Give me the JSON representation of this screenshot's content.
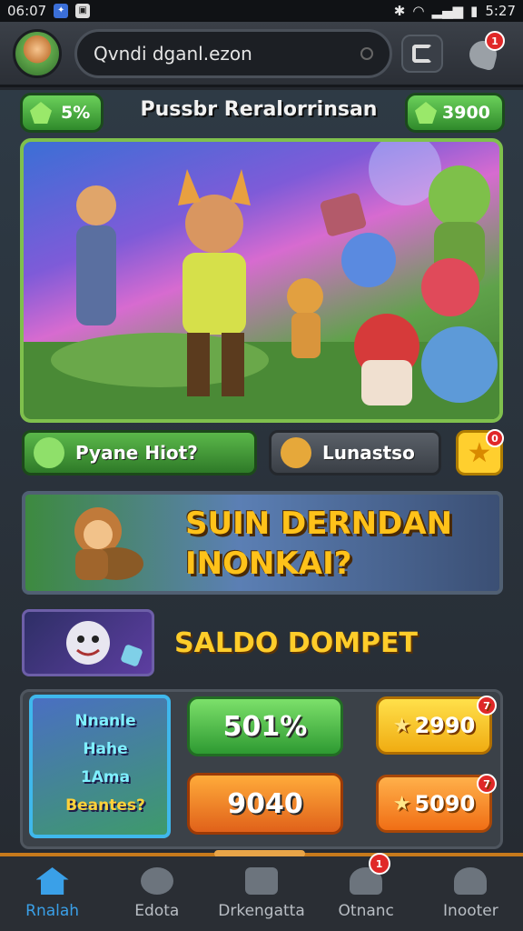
{
  "status": {
    "time_left": "06:07",
    "time_right": "5:27"
  },
  "header": {
    "search_text": "Qvndi dganl.ezon",
    "notification_count": "1"
  },
  "currency_row": {
    "left_value": "5%",
    "title": "Pussbr Reralorrinsan",
    "right_value": "3900"
  },
  "actions": {
    "primary_label": "Pyane Hiot?",
    "secondary_label": "Lunastso",
    "star_badge": "0"
  },
  "banner": {
    "line1": "SUIN DERNDAN",
    "line2": "INONKAI?"
  },
  "wallet": {
    "title": "SALDO DOMPET",
    "card_lines": [
      "Nnanle",
      "Hahe",
      "1Ama",
      "Beantes?"
    ],
    "stat_green": "501%",
    "stat_orange": "9040",
    "coin_top": "2990",
    "coin_top_badge": "7",
    "coin_bottom": "5090",
    "coin_bottom_badge": "7"
  },
  "nav": {
    "items": [
      {
        "label": "Rnalah",
        "icon": "home-icon"
      },
      {
        "label": "Edota",
        "icon": "chat-icon"
      },
      {
        "label": "Drkengatta",
        "icon": "mail-icon"
      },
      {
        "label": "Otnanc",
        "icon": "person-icon"
      },
      {
        "label": "Inooter",
        "icon": "profile-icon"
      }
    ],
    "badge": "1"
  },
  "colors": {
    "accent_green": "#5bb84a",
    "accent_orange": "#f06e15",
    "gold_text": "#ffc21a",
    "nav_active": "#3aa0e8"
  }
}
